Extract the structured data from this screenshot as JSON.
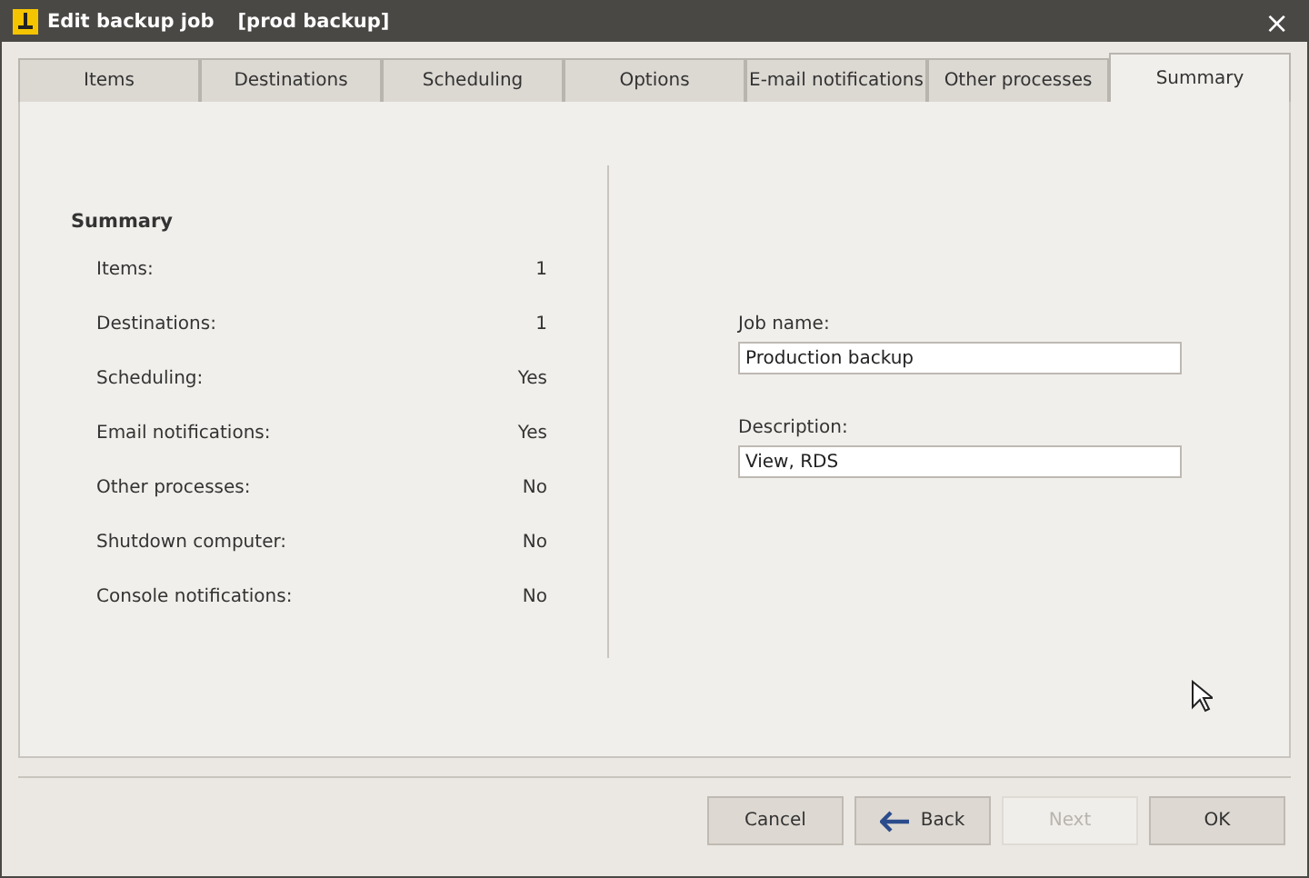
{
  "window": {
    "title": "Edit backup job",
    "subtitle": "[prod backup]",
    "close": "×"
  },
  "tabs": [
    {
      "label": "Items",
      "selected": false
    },
    {
      "label": "Destinations",
      "selected": false
    },
    {
      "label": "Scheduling",
      "selected": false
    },
    {
      "label": "Options",
      "selected": false
    },
    {
      "label": "E-mail notifications",
      "selected": false
    },
    {
      "label": "Other processes",
      "selected": false
    },
    {
      "label": "Summary",
      "selected": true
    }
  ],
  "summary": {
    "heading": "Summary",
    "rows": [
      {
        "label": "Items:",
        "value": "1"
      },
      {
        "label": "Destinations:",
        "value": "1"
      },
      {
        "label": "Scheduling:",
        "value": "Yes"
      },
      {
        "label": "Email notifications:",
        "value": "Yes"
      },
      {
        "label": "Other processes:",
        "value": "No"
      },
      {
        "label": "Shutdown computer:",
        "value": "No"
      },
      {
        "label": "Console notifications:",
        "value": "No"
      }
    ]
  },
  "fields": [
    {
      "label": "Job name:",
      "value": "Production backup"
    },
    {
      "label": "Description:",
      "value": "View, RDS"
    }
  ],
  "buttons": [
    {
      "label": "Cancel",
      "kind": "plain",
      "disabled": false
    },
    {
      "label": "Back",
      "kind": "back",
      "disabled": false
    },
    {
      "label": "Next",
      "kind": "plain",
      "disabled": true
    },
    {
      "label": "OK",
      "kind": "plain",
      "disabled": false
    }
  ]
}
